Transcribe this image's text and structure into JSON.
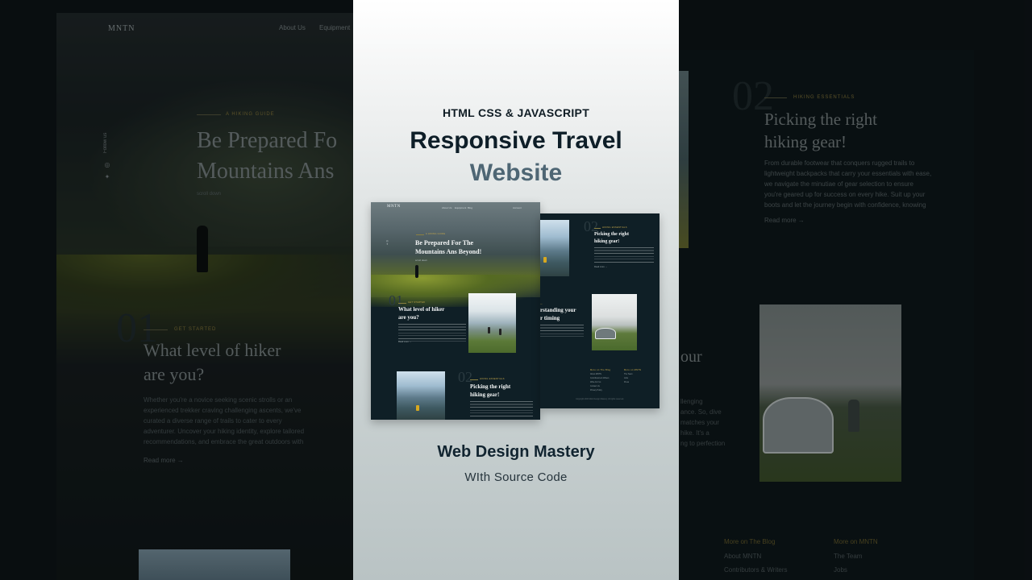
{
  "background": {
    "left": {
      "logo": "MNTN",
      "nav": [
        "About Us",
        "Equipment"
      ],
      "social_label": "Follow us",
      "eyebrow": "A HIKING GUIDE",
      "heading_lines": [
        "Be Prepared Fo",
        "Mountains Ans"
      ],
      "scroll_label": "scroll down",
      "section_number": "01",
      "section_eyebrow": "GET STARTED",
      "section_heading_lines": [
        "What level of hiker",
        "are you?"
      ],
      "section_body_lines": [
        "Whether you're a novice seeking scenic strolls or an",
        "experienced trekker craving challenging ascents, we've",
        "curated a diverse range of trails to cater to every",
        "adventurer. Uncover your hiking identity, explore tailored",
        "recommendations, and embrace the great outdoors with",
        "a newfound understanding of your capabilities."
      ],
      "read_more": "Read more →"
    },
    "right": {
      "section_number": "02",
      "eyebrow": "HIKING ESSENTIALS",
      "heading_lines": [
        "Picking the right",
        "hiking gear!"
      ],
      "body_lines": [
        "From durable footwear that conquers rugged trails to",
        "lightweight backpacks that carry your essentials with ease,",
        "we navigate the minutiae of gear selection to ensure",
        "you're geared up for success on every hike. Suit up your",
        "boots and let the journey begin with confidence, knowing",
        "you've chosen the right gear for the trail ahead!"
      ],
      "read_more": "Read more →",
      "partial_heading": "our",
      "partial_body_lines": [
        "llenging",
        "ance. So, dive",
        "matches your",
        "hike. It's a",
        "ng to perfection"
      ],
      "footer_col1_title": "More on The Blog",
      "footer_col1_links": [
        "About MNTN",
        "Contributors & Writers"
      ],
      "footer_col2_title": "More on MNTN",
      "footer_col2_links": [
        "The Team",
        "Jobs"
      ]
    }
  },
  "card": {
    "kicker": "HTML CSS & JAVASCRIPT",
    "title_line1": "Responsive Travel",
    "title_line2": "Website",
    "footer_title": "Web Design Mastery",
    "footer_subtitle": "WIth Source Code",
    "mockup_a": {
      "logo": "MNTN",
      "nav": [
        "About Us",
        "Equipment",
        "Blog"
      ],
      "account": "Account",
      "eyebrow": "A HIKING GUIDE",
      "hero_lines": [
        "Be Prepared For The",
        "Mountains Ans Beyond!"
      ],
      "scroll": "scroll down",
      "s1_number": "01",
      "s1_eyebrow": "GET STARTED",
      "s1_heading_lines": [
        "What level of hiker",
        "are you?"
      ],
      "s1_read_more": "Read more →",
      "s2_number": "02",
      "s2_eyebrow": "HIKING ESSENTIALS",
      "s2_heading_lines": [
        "Picking the right",
        "hiking gear!"
      ]
    },
    "mockup_b": {
      "s2_number": "02",
      "s2_eyebrow": "HIKING ESSENTIALS",
      "s2_heading_lines": [
        "Picking the right",
        "hiking gear!"
      ],
      "s2_read_more": "Read more →",
      "s3_heading_lines": [
        "rstanding your",
        "r timing"
      ],
      "footer_col1_title": "More on The Blog",
      "footer_col1_links": [
        "About MNTN",
        "Contributors & Writers",
        "Write For Us",
        "Contact Us",
        "Privacy Policy"
      ],
      "footer_col2_title": "More on MNTN",
      "footer_col2_links": [
        "The Team",
        "Jobs",
        "Press"
      ],
      "copyright": "Copyright 2023 Web Design Mastery. All rights reserved."
    }
  },
  "colors": {
    "card_title_dark": "#0e1e28",
    "card_title_accent": "#4e6674",
    "mock_bg": "#0f1f26",
    "gold_accent": "#c8a94a"
  }
}
